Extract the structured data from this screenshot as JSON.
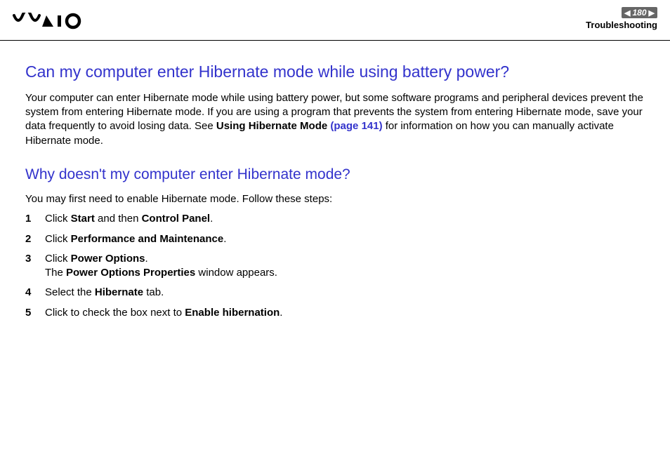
{
  "header": {
    "page_number": "180",
    "section": "Troubleshooting"
  },
  "q1": {
    "heading": "Can my computer enter Hibernate mode while using battery power?",
    "p_before_bold1": "Your computer can enter Hibernate mode while using battery power, but some software programs and peripheral devices prevent the system from entering Hibernate mode. If you are using a program that prevents the system from entering Hibernate mode, save your data frequently to avoid losing data. See ",
    "p_bold1": "Using Hibernate Mode ",
    "p_link": "(page 141)",
    "p_after": " for information on how you can manually activate Hibernate mode."
  },
  "q2": {
    "heading": "Why doesn't my computer enter Hibernate mode?",
    "intro": "You may first need to enable Hibernate mode. Follow these steps:",
    "step1_a": "Click ",
    "step1_b": "Start",
    "step1_c": " and then ",
    "step1_d": "Control Panel",
    "step1_e": ".",
    "step2_a": "Click ",
    "step2_b": "Performance and Maintenance",
    "step2_c": ".",
    "step3_a": "Click ",
    "step3_b": "Power Options",
    "step3_c": ".",
    "step3_sub_a": "The ",
    "step3_sub_b": "Power Options Properties",
    "step3_sub_c": " window appears.",
    "step4_a": "Select the ",
    "step4_b": "Hibernate",
    "step4_c": " tab.",
    "step5_a": "Click to check the box next to ",
    "step5_b": "Enable hibernation",
    "step5_c": "."
  }
}
